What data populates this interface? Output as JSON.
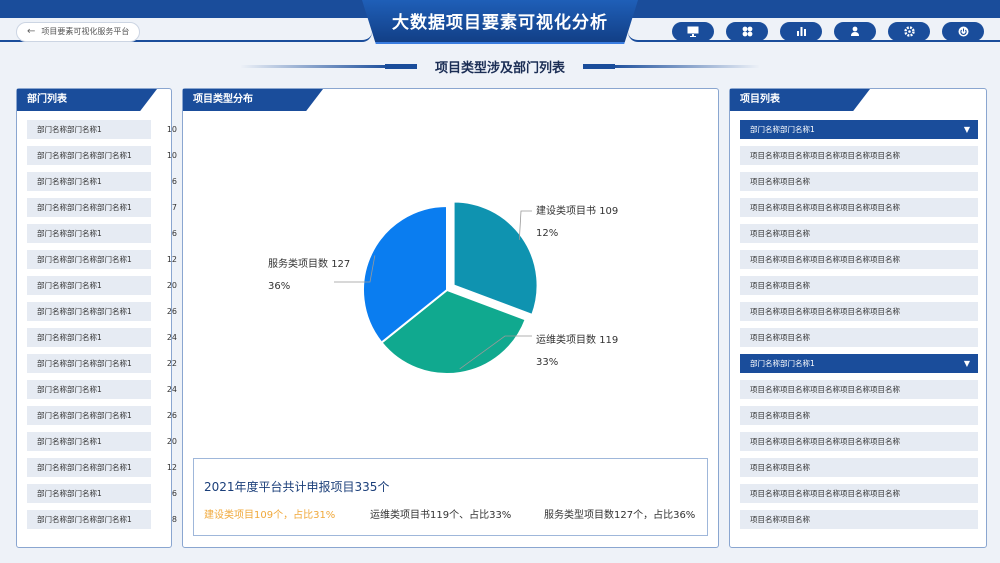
{
  "header": {
    "title": "大数据项目要素可视化分析",
    "back_label": "项目要素可视化服务平台",
    "tools": [
      "monitor-icon",
      "grid-icon",
      "bar-chart-icon",
      "user-icon",
      "gear-icon",
      "power-icon"
    ]
  },
  "section_title": "项目类型涉及部门列表",
  "dept_panel": {
    "title": "部门列表",
    "items": [
      {
        "name": "部门名称部门名称1",
        "count": "10"
      },
      {
        "name": "部门名称部门名称部门名称1",
        "count": "10"
      },
      {
        "name": "部门名称部门名称1",
        "count": "6"
      },
      {
        "name": "部门名称部门名称部门名称1",
        "count": "7"
      },
      {
        "name": "部门名称部门名称1",
        "count": "6"
      },
      {
        "name": "部门名称部门名称部门名称1",
        "count": "12"
      },
      {
        "name": "部门名称部门名称1",
        "count": "20"
      },
      {
        "name": "部门名称部门名称部门名称1",
        "count": "26"
      },
      {
        "name": "部门名称部门名称1",
        "count": "24"
      },
      {
        "name": "部门名称部门名称部门名称1",
        "count": "22"
      },
      {
        "name": "部门名称部门名称1",
        "count": "24"
      },
      {
        "name": "部门名称部门名称部门名称1",
        "count": "26"
      },
      {
        "name": "部门名称部门名称1",
        "count": "20"
      },
      {
        "name": "部门名称部门名称部门名称1",
        "count": "12"
      },
      {
        "name": "部门名称部门名称1",
        "count": "6"
      },
      {
        "name": "部门名称部门名称部门名称1",
        "count": "8"
      }
    ]
  },
  "type_panel": {
    "title": "项目类型分布",
    "pie": {
      "slices": [
        {
          "name": "建设类项目书",
          "value": 109,
          "percent": "12%",
          "color": "#0f93b0"
        },
        {
          "name": "运维类项目数",
          "value": 119,
          "percent": "33%",
          "color": "#10a98f"
        },
        {
          "name": "服务类项目数",
          "value": 127,
          "percent": "36%",
          "color": "#0a7df0"
        }
      ]
    },
    "summary": {
      "title": "2021年度平台共计申报项目335个",
      "items": [
        "建设类项目109个，占比31%",
        "运维类项目书119个、占比33%",
        "服务类型项目数127个，占比36%"
      ]
    }
  },
  "project_panel": {
    "title": "项目列表",
    "rows": [
      {
        "text": "部门名称部门名称1",
        "group": true
      },
      {
        "text": "项目名称项目名称项目名称项目名称项目名称",
        "group": false
      },
      {
        "text": "项目名称项目名称",
        "group": false
      },
      {
        "text": "项目名称项目名称项目名称项目名称项目名称",
        "group": false
      },
      {
        "text": "项目名称项目名称",
        "group": false
      },
      {
        "text": "项目名称项目名称项目名称项目名称项目名称",
        "group": false
      },
      {
        "text": "项目名称项目名称",
        "group": false
      },
      {
        "text": "项目名称项目名称项目名称项目名称项目名称",
        "group": false
      },
      {
        "text": "项目名称项目名称",
        "group": false
      },
      {
        "text": "部门名称部门名称1",
        "group": true
      },
      {
        "text": "项目名称项目名称项目名称项目名称项目名称",
        "group": false
      },
      {
        "text": "项目名称项目名称",
        "group": false
      },
      {
        "text": "项目名称项目名称项目名称项目名称项目名称",
        "group": false
      },
      {
        "text": "项目名称项目名称",
        "group": false
      },
      {
        "text": "项目名称项目名称项目名称项目名称项目名称",
        "group": false
      },
      {
        "text": "项目名称项目名称",
        "group": false
      }
    ]
  }
}
